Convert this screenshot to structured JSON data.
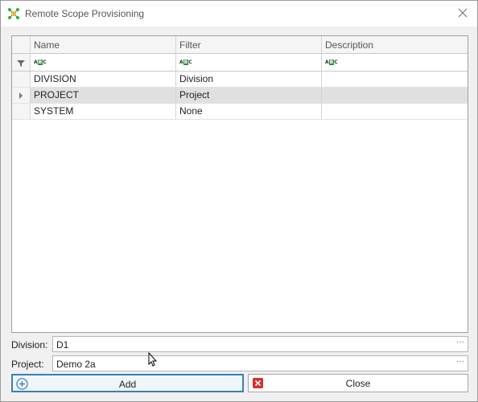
{
  "window": {
    "title": "Remote Scope Provisioning",
    "icon": "network-node-icon"
  },
  "grid": {
    "columns": [
      "Name",
      "Filter",
      "Description"
    ],
    "filter_row_icon": "funnel-icon",
    "filter_cell_icon": "abc-text-filter-icon",
    "rows": [
      {
        "name": "DIVISION",
        "filter": "Division",
        "description": ""
      },
      {
        "name": "PROJECT",
        "filter": "Project",
        "description": "",
        "selected": true
      },
      {
        "name": "SYSTEM",
        "filter": "None",
        "description": ""
      }
    ]
  },
  "fields": {
    "division": {
      "label": "Division:",
      "value": "D1",
      "button": "···"
    },
    "project": {
      "label": "Project:",
      "value": "Demo 2a",
      "button": "···"
    }
  },
  "buttons": {
    "add": {
      "label": "Add",
      "icon": "plus-circle-icon",
      "icon_color": "#3c7fb1"
    },
    "close": {
      "label": "Close",
      "icon": "red-x-icon",
      "icon_color": "#d9302c"
    }
  },
  "colors": {
    "selection": "#e0e0e0",
    "focus_border": "#3c7fb1",
    "abc_badge": "#2f8f3e"
  }
}
